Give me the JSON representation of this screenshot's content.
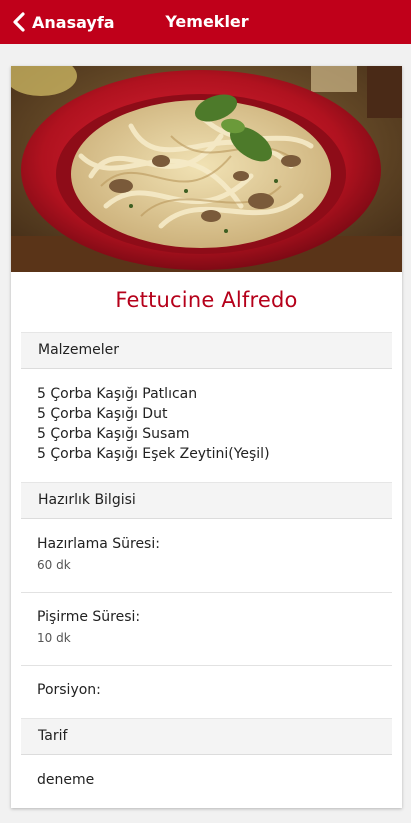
{
  "header": {
    "back_label": "Anasayfa",
    "title": "Yemekler",
    "background": "#c0001a"
  },
  "recipe": {
    "title": "Fettucine Alfredo",
    "title_color": "#b5001a",
    "image_alt": "fettuccine-with-mushrooms-and-basil-photo"
  },
  "ingredients_section": {
    "heading": "Malzemeler",
    "items": [
      "5 Çorba Kaşığı Patlıcan",
      "5 Çorba Kaşığı Dut",
      "5 Çorba Kaşığı Susam",
      "5 Çorba Kaşığı Eşek Zeytini(Yeşil)"
    ]
  },
  "prep_section": {
    "heading": "Hazırlık Bilgisi",
    "prep_time_label": "Hazırlama Süresi:",
    "prep_time_value": "60 dk",
    "cook_time_label": "Pişirme Süresi:",
    "cook_time_value": "10 dk",
    "servings_label": "Porsiyon:"
  },
  "instructions_section": {
    "heading": "Tarif",
    "text": "deneme"
  }
}
